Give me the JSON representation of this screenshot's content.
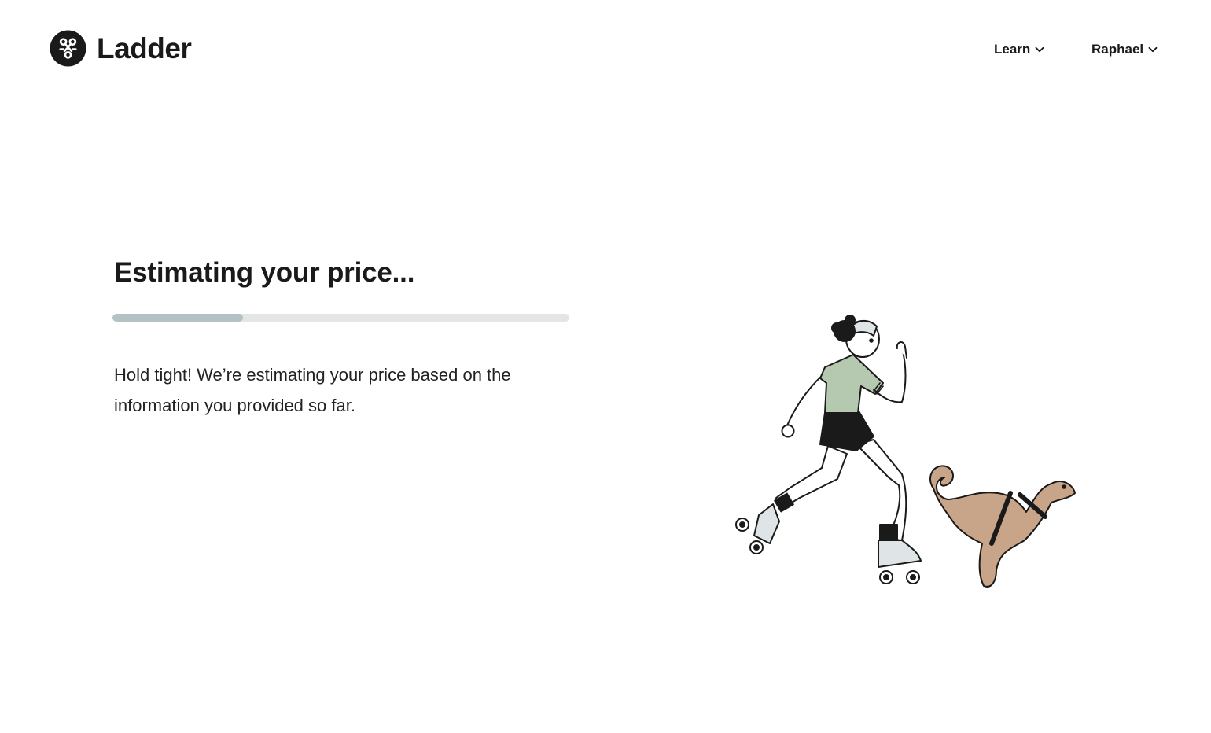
{
  "header": {
    "brand": "Ladder",
    "nav": {
      "learn_label": "Learn",
      "user_label": "Raphael"
    }
  },
  "main": {
    "title": "Estimating your price...",
    "progress": 0.285,
    "description": "Hold tight! We’re estimating your price based on the information you provided so far."
  },
  "icons": {
    "logo": "ladder-logo-icon",
    "learn_chevron": "chevron-down-icon",
    "user_chevron": "chevron-down-icon",
    "illustration": "roller-skater-and-dog-illustration"
  },
  "colors": {
    "text": "#1a1a1a",
    "progress_track": "#e4e6e6",
    "progress_fill": "#b3c3c5",
    "shirt": "#b5c9b0",
    "dog": "#c8a488"
  }
}
